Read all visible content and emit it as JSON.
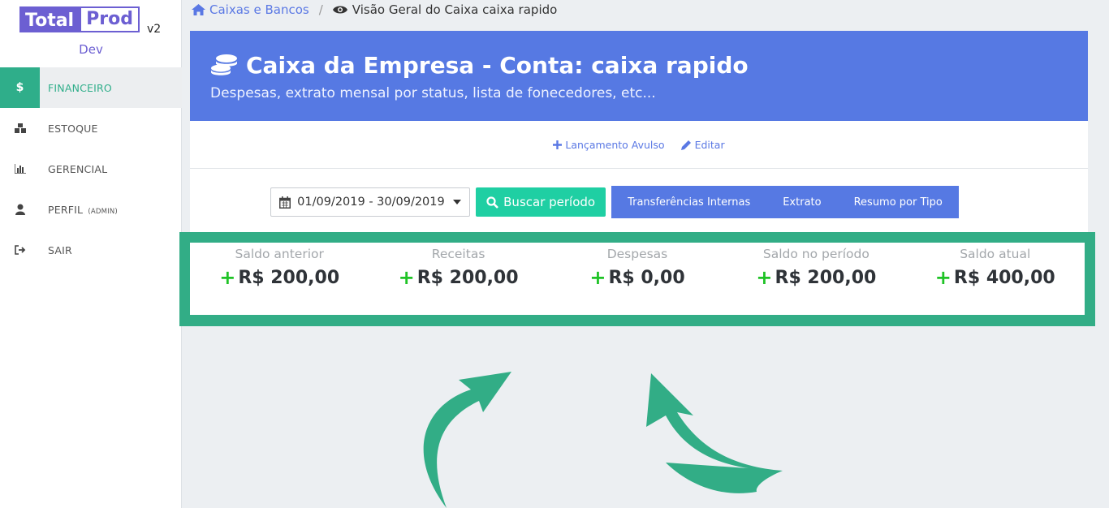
{
  "sidebar": {
    "logo_total": "Total",
    "logo_prod": "Prod",
    "logo_version": "v2",
    "env": "Dev",
    "items": [
      {
        "icon_char": "$",
        "label": "FINANCEIRO",
        "tag": ""
      },
      {
        "icon_char": "▟",
        "label": "ESTOQUE",
        "tag": ""
      },
      {
        "icon_char": "▥",
        "label": "GERENCIAL",
        "tag": ""
      },
      {
        "icon_char": "●",
        "label": "PERFIL",
        "tag": "(ADMIN)"
      },
      {
        "icon_char": "➜",
        "label": "SAIR",
        "tag": ""
      }
    ]
  },
  "breadcrumb": {
    "home_label": "Caixas e Bancos",
    "separator": "/",
    "current_label": "Visão Geral do Caixa caixa rapido"
  },
  "header": {
    "title": "Caixa da Empresa - Conta: caixa rapido",
    "subtitle": "Despesas, extrato mensal por status, lista de fonecedores, etc..."
  },
  "actions": {
    "lancamento_label": "Lançamento Avulso",
    "editar_label": "Editar"
  },
  "filter": {
    "date_range": "01/09/2019 - 30/09/2019",
    "search_label": "Buscar período",
    "buttons": [
      "Transferências Internas",
      "Extrato",
      "Resumo por Tipo"
    ]
  },
  "summary": [
    {
      "label": "Saldo anterior",
      "value": "R$ 200,00"
    },
    {
      "label": "Receitas",
      "value": "R$ 200,00"
    },
    {
      "label": "Despesas",
      "value": "R$ 0,00"
    },
    {
      "label": "Saldo no período",
      "value": "R$ 200,00"
    },
    {
      "label": "Saldo atual",
      "value": "R$ 400,00"
    }
  ],
  "colors": {
    "accent_blue": "#5679e3",
    "accent_green": "#2fae8a",
    "search_button": "#1fcfa3",
    "plus_sign": "#1fc326",
    "brand_purple": "#6c5fd2"
  }
}
